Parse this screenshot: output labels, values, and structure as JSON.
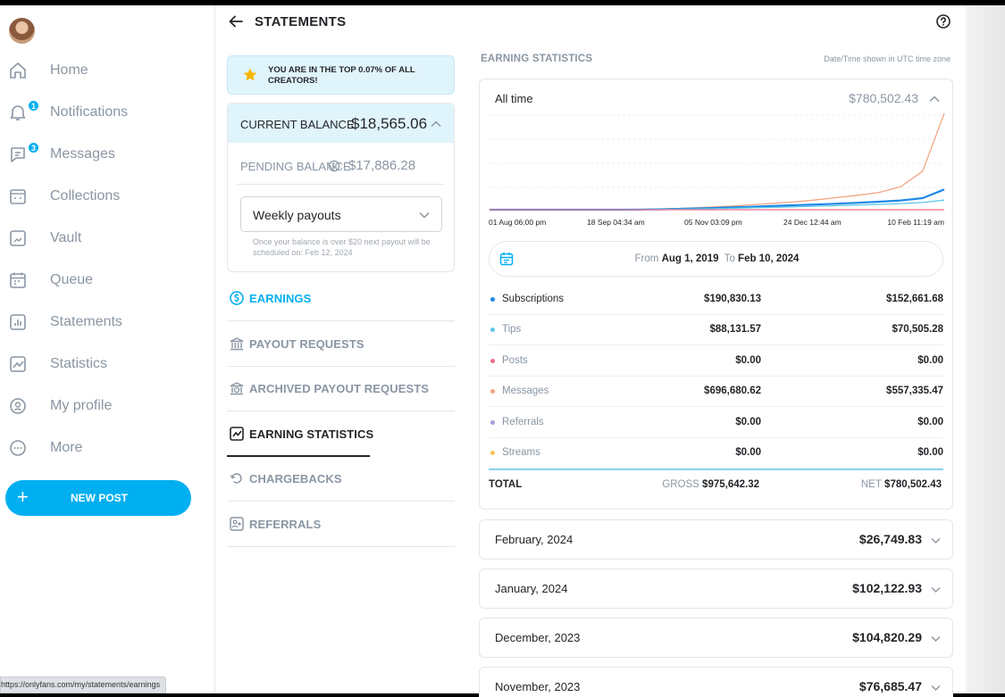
{
  "sidebar": {
    "items": [
      {
        "label": "Home",
        "icon": "home-icon"
      },
      {
        "label": "Notifications",
        "icon": "bell-icon",
        "badge": "1"
      },
      {
        "label": "Messages",
        "icon": "message-icon",
        "badge": "3"
      },
      {
        "label": "Collections",
        "icon": "collections-icon"
      },
      {
        "label": "Vault",
        "icon": "vault-icon"
      },
      {
        "label": "Queue",
        "icon": "calendar-icon"
      },
      {
        "label": "Statements",
        "icon": "statements-icon"
      },
      {
        "label": "Statistics",
        "icon": "statistics-icon"
      },
      {
        "label": "My profile",
        "icon": "profile-icon"
      },
      {
        "label": "More",
        "icon": "more-icon"
      }
    ],
    "new_post_label": "NEW POST"
  },
  "status_url": "https://onlyfans.com/my/statements/earnings",
  "header": {
    "title": "STATEMENTS"
  },
  "left": {
    "top_banner": "YOU ARE IN THE TOP 0.07% OF ALL CREATORS!",
    "current_balance_label": "CURRENT BALANCE",
    "current_balance_value": "$18,565.06",
    "pending_balance_label": "PENDING BALANCE",
    "pending_balance_value": "$17,886.28",
    "payout_select_value": "Weekly payouts",
    "payout_note": "Once your balance is over $20 next payout will be scheduled on: Feb 12, 2024",
    "menu": [
      {
        "label": "EARNINGS",
        "icon": "dollar-circle-icon",
        "state": "blue"
      },
      {
        "label": "PAYOUT REQUESTS",
        "icon": "bank-icon",
        "state": ""
      },
      {
        "label": "ARCHIVED PAYOUT REQUESTS",
        "icon": "archived-bank-icon",
        "state": ""
      },
      {
        "label": "EARNING STATISTICS",
        "icon": "chart-icon",
        "state": "active"
      },
      {
        "label": "CHARGEBACKS",
        "icon": "chargeback-icon",
        "state": ""
      },
      {
        "label": "REFERRALS",
        "icon": "referral-icon",
        "state": ""
      }
    ]
  },
  "right": {
    "title": "EARNING STATISTICS",
    "timezone_note": "Date/Time shown in UTC time zone",
    "period_label": "All time",
    "period_total": "$780,502.43",
    "date_from_label": "From",
    "date_from": "Aug 1, 2019",
    "date_to_label": "To",
    "date_to": "Feb 10, 2024",
    "categories": [
      {
        "name": "Subscriptions",
        "gross": "$190,830.13",
        "net": "$152,661.68",
        "color": "#1e88e5",
        "muted": false
      },
      {
        "name": "Tips",
        "gross": "$88,131.57",
        "net": "$70,505.28",
        "color": "#5ec8e8",
        "muted": true
      },
      {
        "name": "Posts",
        "gross": "$0.00",
        "net": "$0.00",
        "color": "#f06e8a",
        "muted": true
      },
      {
        "name": "Messages",
        "gross": "$696,680.62",
        "net": "$557,335.47",
        "color": "#f4a582",
        "muted": true
      },
      {
        "name": "Referrals",
        "gross": "$0.00",
        "net": "$0.00",
        "color": "#a99bd9",
        "muted": true
      },
      {
        "name": "Streams",
        "gross": "$0.00",
        "net": "$0.00",
        "color": "#f7c25a",
        "muted": true
      }
    ],
    "total_label": "TOTAL",
    "gross_label": "GROSS",
    "gross_total": "$975,642.32",
    "net_label": "NET",
    "net_total": "$780,502.43",
    "months": [
      {
        "label": "February, 2024",
        "value": "$26,749.83"
      },
      {
        "label": "January, 2024",
        "value": "$102,122.93"
      },
      {
        "label": "December, 2023",
        "value": "$104,820.29"
      },
      {
        "label": "November, 2023",
        "value": "$76,685.47"
      }
    ]
  },
  "chart_data": {
    "type": "line",
    "x_tick_labels": [
      "01 Aug 06:00 pm",
      "18 Sep 04:34 am",
      "05 Nov 03:09 pm",
      "24 Dec 12:44 am",
      "10 Feb 11:19 am"
    ],
    "grid": true,
    "series": [
      {
        "name": "Messages",
        "color": "#f4a582",
        "values": [
          0,
          0,
          0,
          0,
          0,
          0,
          0,
          0.3,
          0.8,
          1.5,
          2.5,
          3.6,
          5,
          6.5,
          8,
          10,
          12.5,
          15,
          18,
          24,
          40,
          100
        ]
      },
      {
        "name": "Subscriptions",
        "color": "#1e88e5",
        "values": [
          0,
          0,
          0,
          0,
          0,
          0,
          0,
          0.2,
          0.5,
          1,
          1.6,
          2.3,
          3,
          3.8,
          4.6,
          5.4,
          6.2,
          7.2,
          8.3,
          9.6,
          12,
          21
        ]
      },
      {
        "name": "Tips",
        "color": "#5ec8e8",
        "values": [
          0,
          0,
          0,
          0,
          0,
          0,
          0,
          0.1,
          0.3,
          0.6,
          1,
          1.4,
          1.9,
          2.4,
          3,
          3.6,
          4.2,
          4.9,
          5.6,
          6.4,
          7.5,
          10
        ]
      },
      {
        "name": "Posts",
        "color": "#f06e8a",
        "values": [
          0,
          0,
          0,
          0,
          0,
          0,
          0,
          0,
          0,
          0,
          0,
          0,
          0,
          0,
          0,
          0,
          0,
          0,
          0,
          0,
          0,
          0
        ]
      }
    ]
  }
}
